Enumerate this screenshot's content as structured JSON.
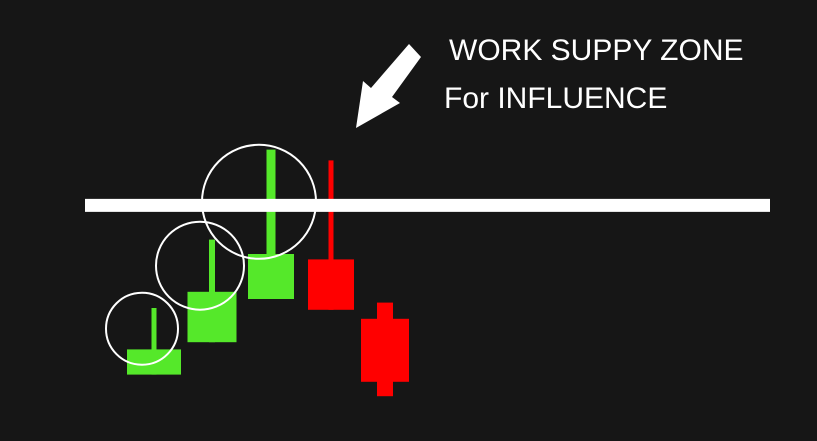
{
  "annotation": {
    "line1": "WORK SUPPY ZONE",
    "line2": "For INFLUENCE"
  },
  "colors": {
    "background": "#161616",
    "bullish": "#55e82a",
    "bearish": "#ff0000",
    "zone_line": "#ffffff",
    "highlight_circle": "#ffffff",
    "arrow": "#ffffff"
  },
  "chart_data": {
    "type": "candlestick",
    "title": "",
    "xlabel": "",
    "ylabel": "",
    "grid": false,
    "legend": "none",
    "axes_visible": false,
    "ylim": [
      0,
      100
    ],
    "candles": [
      {
        "index": 1,
        "direction": "bullish",
        "open": 13,
        "close": 27,
        "high": 50,
        "low": 13,
        "wick_highlighted": true
      },
      {
        "index": 2,
        "direction": "bullish",
        "open": 31,
        "close": 59,
        "high": 88,
        "low": 31,
        "wick_highlighted": true
      },
      {
        "index": 3,
        "direction": "bullish",
        "open": 55,
        "close": 80,
        "high": 138,
        "low": 55,
        "wick_highlighted": true
      },
      {
        "index": 4,
        "direction": "bearish",
        "open": 77,
        "close": 49,
        "high": 132,
        "low": 49,
        "wick_highlighted": false
      },
      {
        "index": 5,
        "direction": "bearish",
        "open": 44,
        "close": 9,
        "high": 53,
        "low": 1,
        "wick_highlighted": false
      }
    ],
    "supply_zone_level": 107,
    "annotation_arrow": {
      "points_to": "supply-zone-line"
    }
  }
}
